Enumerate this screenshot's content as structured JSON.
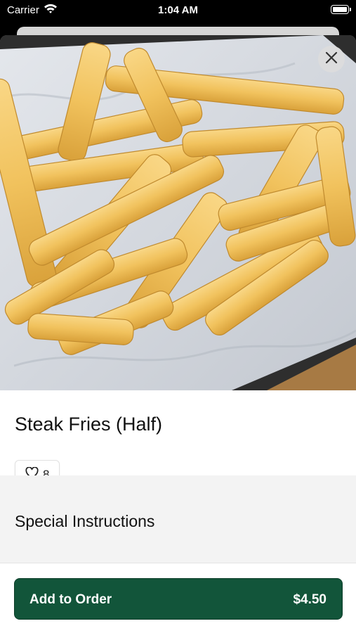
{
  "status_bar": {
    "carrier": "Carrier",
    "time": "1:04 AM"
  },
  "item": {
    "image_alt": "Basket of steak fries on parchment paper",
    "title": "Steak Fries (Half)",
    "likes": "8"
  },
  "special_instructions": {
    "title": "Special Instructions"
  },
  "order": {
    "add_label": "Add to Order",
    "price": "$4.50"
  },
  "colors": {
    "accent": "#12553a",
    "section_bg": "#f3f3f3"
  },
  "icons": {
    "close": "close-icon",
    "like": "heart-icon",
    "wifi": "wifi-icon",
    "battery": "battery-icon"
  }
}
